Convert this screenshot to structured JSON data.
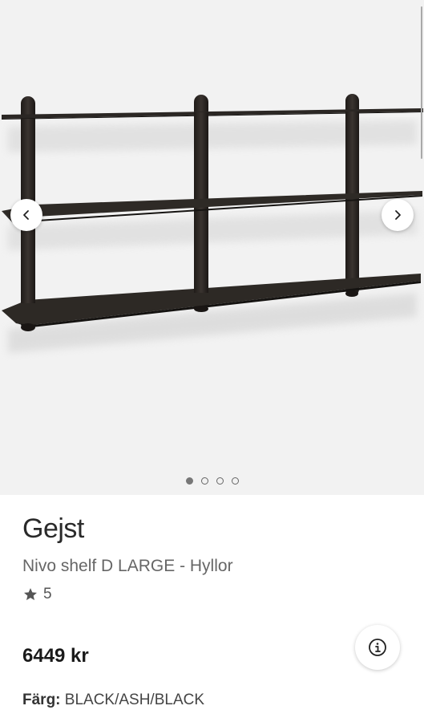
{
  "gallery": {
    "image_alt": "Nivo shelf D LARGE",
    "prev_icon": "chevron-left-icon",
    "next_icon": "chevron-right-icon",
    "slides": 4,
    "active_slide": 1
  },
  "product": {
    "brand": "Gejst",
    "name": "Nivo shelf D LARGE - Hyllor",
    "rating": "5",
    "price": "6449 kr",
    "color_label": "Färg:",
    "color_value": "BLACK/ASH/BLACK"
  },
  "icons": {
    "star": "star-icon",
    "info": "info-icon"
  },
  "colors": {
    "gallery_bg": "#f2f2f2",
    "shelf": "#2b2724",
    "text_dark": "#2a2a2a",
    "text_muted": "#666666"
  }
}
